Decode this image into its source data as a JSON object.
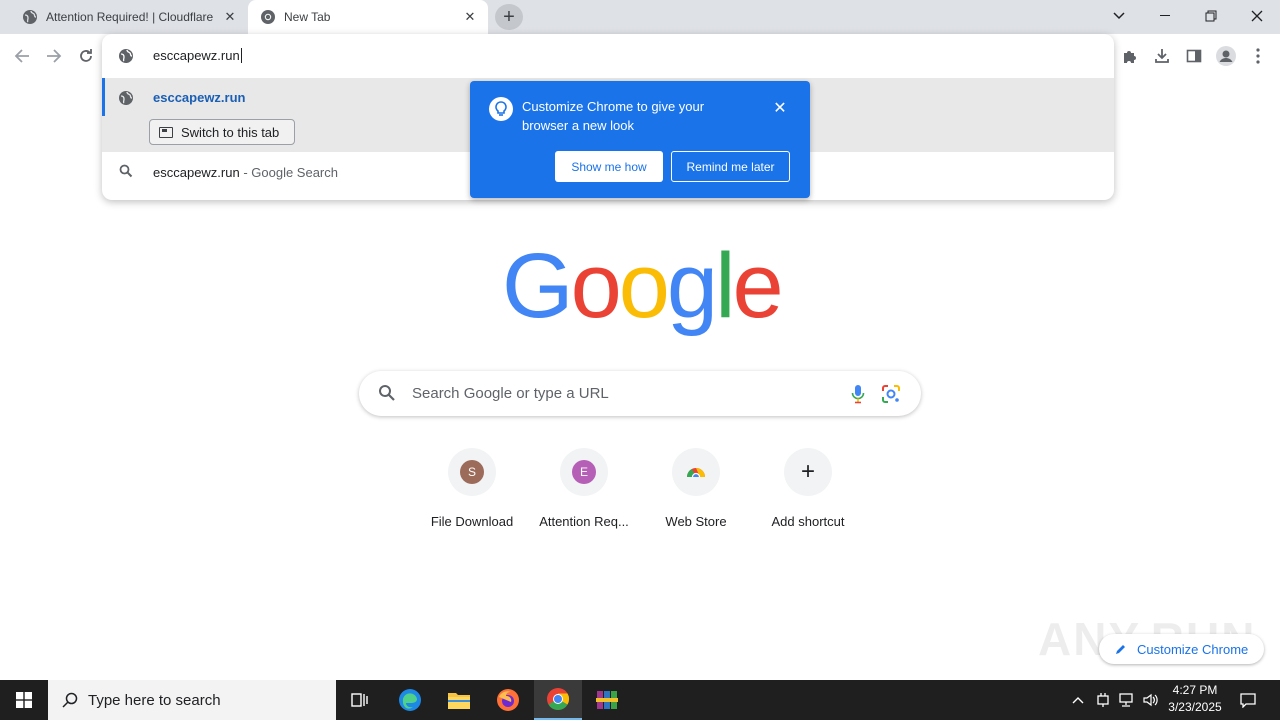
{
  "browser": {
    "tabs": [
      {
        "title": "Attention Required! | Cloudflare",
        "active": false
      },
      {
        "title": "New Tab",
        "active": true
      }
    ],
    "new_tab_icon": "plus-icon",
    "window_controls": [
      "chevron-down-icon",
      "minimize-icon",
      "restore-icon",
      "close-icon"
    ]
  },
  "omnibox": {
    "input_value": "esccapewz.run",
    "suggestions": {
      "site_url": "esccapewz.run",
      "switch_tab_label": "Switch to this tab",
      "search_query": "esccapewz.run",
      "search_suffix": " - Google Search"
    }
  },
  "promo": {
    "text": "Customize Chrome to give your browser a new look",
    "show_label": "Show me how",
    "remind_label": "Remind me later"
  },
  "ntp": {
    "logo_letters": [
      "G",
      "o",
      "o",
      "g",
      "l",
      "e"
    ],
    "logo_colors": [
      "#4285F4",
      "#EA4335",
      "#FBBC05",
      "#4285F4",
      "#34A853",
      "#EA4335"
    ],
    "search_placeholder": "Search Google or type a URL",
    "shortcuts": [
      {
        "label": "File Download",
        "letter": "S",
        "color": "#9c6b5a"
      },
      {
        "label": "Attention Req...",
        "letter": "E",
        "color": "#b65fb6"
      },
      {
        "label": "Web Store",
        "letter": "",
        "color": ""
      },
      {
        "label": "Add shortcut",
        "letter": "+",
        "color": ""
      }
    ],
    "customize_label": "Customize Chrome",
    "watermark": "ANY.RUN"
  },
  "taskbar": {
    "search_placeholder": "Type here to search",
    "time": "4:27 PM",
    "date": "3/23/2025"
  },
  "colors": {
    "accent": "#1a73e8",
    "tabstrip": "#dee1e6",
    "taskbar": "#1f1f1f"
  }
}
